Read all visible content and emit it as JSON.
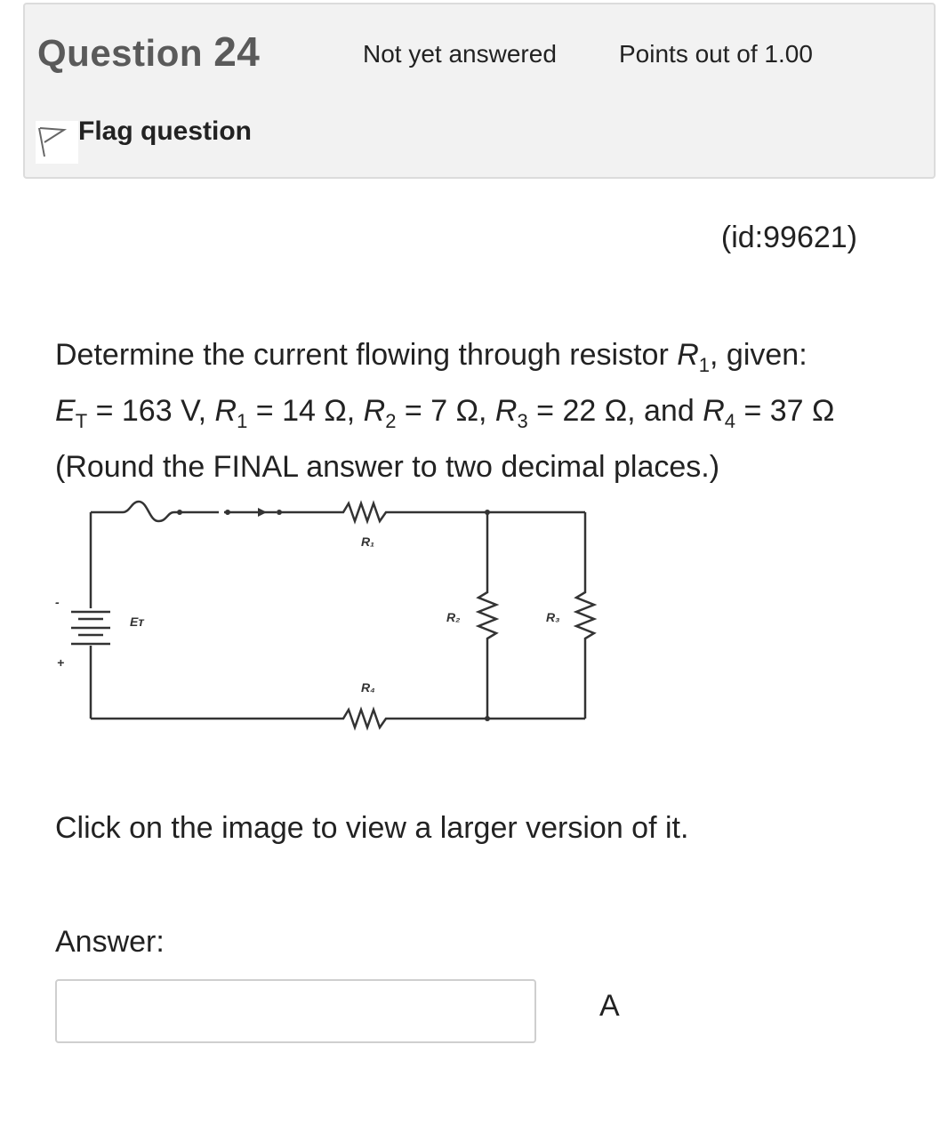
{
  "info": {
    "question_label": "Question",
    "question_number": "24",
    "state": "Not yet answered",
    "grade": "Points out of 1.00",
    "flag_label": "Flag question",
    "flag_icon": "flag-outline-icon"
  },
  "question": {
    "id_text": "(id:99621)",
    "line1_pre": "Determine the current flowing through resistor ",
    "line1_var": "R",
    "line1_sub": "1",
    "line1_post": ", given:",
    "given": [
      {
        "var": "E",
        "sub": "T",
        "value": " = 163 V, "
      },
      {
        "var": "R",
        "sub": "1",
        "value": " = 14 Ω, "
      },
      {
        "var": "R",
        "sub": "2",
        "value": " = 7 Ω, "
      },
      {
        "var": "R",
        "sub": "3",
        "value": " = 22 Ω, and "
      },
      {
        "var": "R",
        "sub": "4",
        "value": " = 37 Ω"
      }
    ],
    "rounding_note": "(Round the FINAL answer to two decimal places.)",
    "click_note": "Click on the image to view a larger version of it."
  },
  "circuit": {
    "labels": {
      "r1": "R₁",
      "r2": "R₂",
      "r3": "R₃",
      "r4": "R₄",
      "source": "Eᴛ",
      "minus": "-",
      "plus": "+"
    }
  },
  "answer": {
    "label": "Answer:",
    "value": "",
    "unit": "A"
  }
}
